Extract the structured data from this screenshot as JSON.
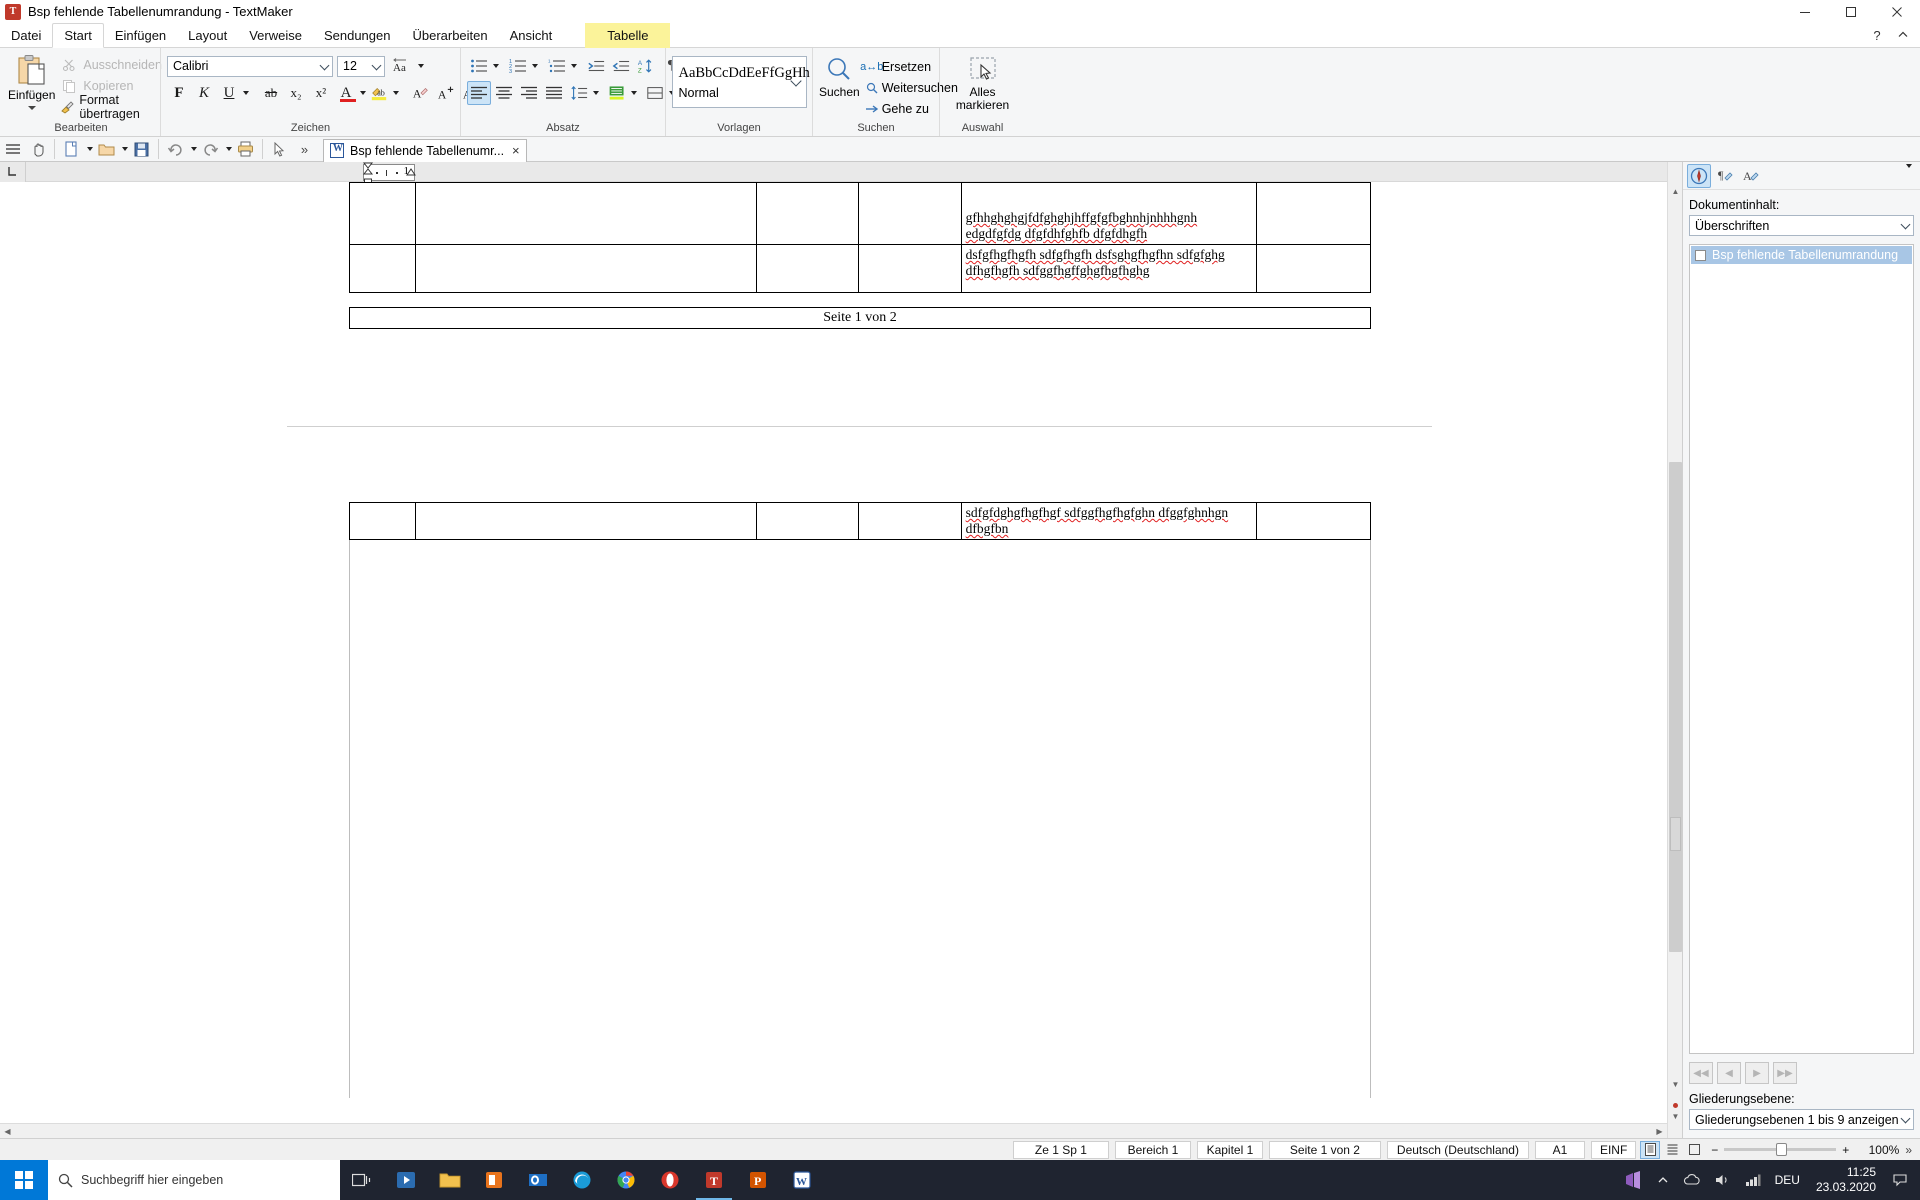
{
  "window": {
    "title": "Bsp fehlende Tabellenumrandung - TextMaker",
    "app_icon": "textmaker-icon",
    "minimize": "minimize-button",
    "maximize": "maximize-button",
    "close": "close-button"
  },
  "menubar": {
    "items": [
      {
        "label": "Datei",
        "active": false
      },
      {
        "label": "Start",
        "active": true
      },
      {
        "label": "Einfügen",
        "active": false
      },
      {
        "label": "Layout",
        "active": false
      },
      {
        "label": "Verweise",
        "active": false
      },
      {
        "label": "Sendungen",
        "active": false
      },
      {
        "label": "Überarbeiten",
        "active": false
      },
      {
        "label": "Ansicht",
        "active": false
      }
    ],
    "context_tab": "Tabelle",
    "help_label": "?",
    "collapse_label": "⌃"
  },
  "ribbon": {
    "groups": [
      {
        "label": "Bearbeiten"
      },
      {
        "label": "Zeichen"
      },
      {
        "label": "Absatz"
      },
      {
        "label": "Vorlagen"
      },
      {
        "label": "Suchen"
      },
      {
        "label": "Auswahl"
      }
    ],
    "clipboard": {
      "paste_label": "Einfügen",
      "cut_label": "Ausschneiden",
      "copy_label": "Kopieren",
      "format_label": "Format übertragen"
    },
    "font": {
      "family_value": "Calibri",
      "size_value": "12",
      "bold_label": "F",
      "italic_label": "K",
      "underline_label": "U",
      "strike_label": "ab",
      "subscript_label": "x₂",
      "superscript_label": "x²",
      "color_label": "A",
      "highlight_label": "ab",
      "clear_label": "A",
      "grow_label": "A⁺",
      "shrink_label": "A⁻",
      "case_label": "Aa"
    },
    "styles": {
      "preview_text": "AaBbCcDdEeFfGgHh",
      "style_name": "Normal"
    },
    "search": {
      "find_label": "Suchen",
      "replace_label": "Ersetzen",
      "find_next_label": "Weitersuchen",
      "goto_label": "Gehe zu"
    },
    "selection": {
      "select_all_line1": "Alles",
      "select_all_line2": "markieren"
    }
  },
  "quickaccess": {
    "buttons": [
      "menu-icon",
      "hand-icon",
      "new-icon",
      "open-icon",
      "save-icon",
      "undo-icon",
      "redo-icon",
      "print-icon",
      "pointer-icon",
      "more-icon"
    ]
  },
  "doctabs": {
    "tabs": [
      {
        "label": "Bsp fehlende Tabellenumr...",
        "close": "×",
        "active": true
      }
    ]
  },
  "ruler": {
    "marker_label": "1"
  },
  "document": {
    "page1": {
      "table_rows": [
        {
          "cells": [
            "",
            "",
            "",
            "",
            ""
          ]
        },
        {
          "cells": [
            "",
            "",
            "",
            "",
            "gfhhghghgjfdfghghjhffgfgfbghnhjnhhhgnh edgdfgfdg dfgfdhfghfb dfgfdhgfh"
          ]
        },
        {
          "cells": [
            "",
            "",
            "",
            "",
            "dsfgfhgfhgfh sdfgfhgfh dsfsghgfhgfhn sdfgfghg dfhgfhgfh sdfggfhgffghgfhgfhghg"
          ]
        }
      ],
      "footer_text": "Seite 1 von 2"
    },
    "page2": {
      "table_rows": [
        {
          "cells": [
            "",
            "",
            "",
            "",
            "sdfgfdghgfhgfhgf sdfggfhgfhgfghn dfggfghnhgn dfbgfbn"
          ]
        }
      ]
    }
  },
  "sidebar": {
    "tools": [
      {
        "name": "navigator-icon",
        "selected": true
      },
      {
        "name": "paragraph-mark-icon",
        "selected": false
      },
      {
        "name": "character-format-icon",
        "selected": false
      }
    ],
    "dropdown_caret": "chevron-down-icon",
    "content_label": "Dokumentinhalt:",
    "content_value": "Überschriften",
    "tree_items": [
      {
        "label": "Bsp fehlende Tabellenumrandung",
        "selected": true
      }
    ],
    "nav_buttons": [
      "first-icon",
      "prev-icon",
      "next-icon",
      "last-icon"
    ],
    "outline_label": "Gliederungsebene:",
    "outline_value": "Gliederungsebenen 1 bis 9 anzeigen"
  },
  "statusbar": {
    "cells": [
      "Ze 1 Sp 1",
      "Bereich 1",
      "Kapitel 1",
      "Seite 1 von 2",
      "Deutsch (Deutschland)",
      "A1",
      "EINF"
    ],
    "view_icons": [
      "page-view-icon",
      "continuous-view-icon",
      "draft-view-icon"
    ],
    "zoom_minus": "−",
    "zoom_plus": "+",
    "zoom_value": "100%",
    "overflow": "»"
  },
  "taskbar": {
    "start_label": "start-icon",
    "search_placeholder": "Suchbegriff hier eingeben",
    "search_icon": "search-icon",
    "items": [
      "task-view-icon",
      "media-player-icon",
      "file-explorer-icon",
      "office-icon",
      "outlook-icon",
      "edge-icon",
      "chrome-icon",
      "opera-icon",
      "textmaker-icon",
      "presentations-icon",
      "word-icon"
    ],
    "tray": [
      "vs-icon",
      "chevron-up-icon",
      "onedrive-icon",
      "volume-icon",
      "network-icon"
    ],
    "language": "DEU",
    "time": "11:25",
    "date": "23.03.2020",
    "notification": "notification-icon"
  },
  "colors": {
    "accent": "#0078d7",
    "context_tab": "#fbf39a",
    "selection": "#cce4f7",
    "spell_error": "#e02020",
    "taskbar": "#1f2430"
  }
}
